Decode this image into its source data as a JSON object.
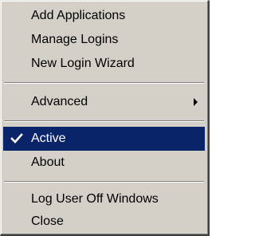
{
  "menu": {
    "items": [
      {
        "label": "Add Applications"
      },
      {
        "label": "Manage Logins"
      },
      {
        "label": "New Login Wizard"
      },
      {
        "label": "Advanced",
        "submenu": true
      },
      {
        "label": "Active",
        "checked": true,
        "highlighted": true
      },
      {
        "label": "About"
      },
      {
        "label": "Log User Off Windows"
      },
      {
        "label": "Close"
      }
    ],
    "icons": {
      "check": "checkmark-icon",
      "submenu": "submenu-arrow-icon"
    },
    "colors": {
      "menu_background": "#d4d0c8",
      "highlight_background": "#0a246a",
      "highlight_text": "#ffffff",
      "text": "#000000"
    }
  }
}
